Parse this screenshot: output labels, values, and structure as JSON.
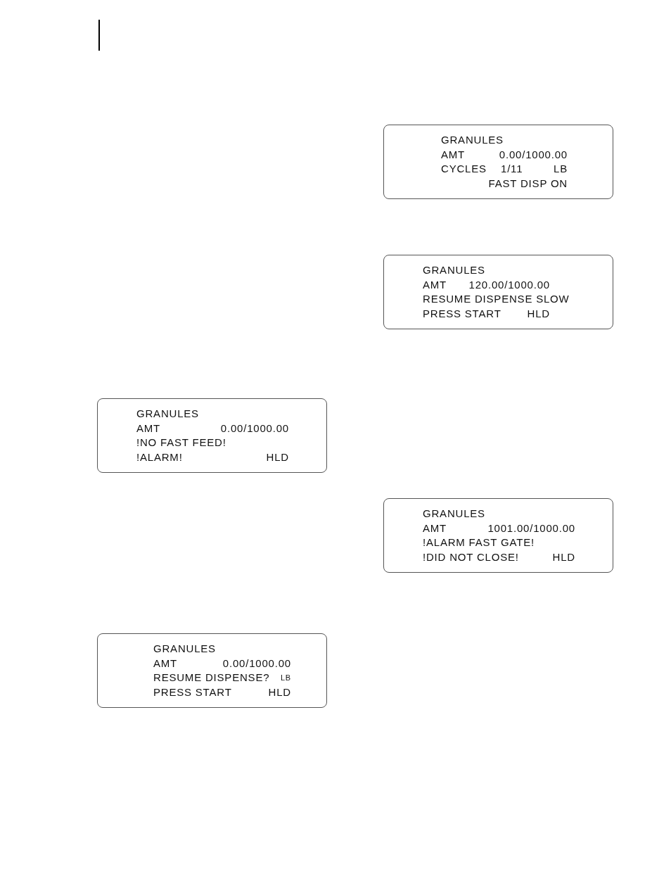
{
  "left_column": {
    "displays": [
      {
        "material": "GRANULES",
        "lines": [
          {
            "label": "AMT",
            "value": "0.00/1000.00"
          },
          {
            "label": "!NO FAST FEED!"
          },
          {
            "label": "!ALARM!",
            "status": "HLD"
          }
        ]
      },
      {
        "material": "GRANULES",
        "lines": [
          {
            "label": "AMT",
            "value": "0.00/1000.00"
          },
          {
            "label": "RESUME DISPENSE?",
            "unit": "LB"
          },
          {
            "label": "PRESS START",
            "status": "HLD"
          }
        ]
      }
    ]
  },
  "right_column": {
    "displays": [
      {
        "material": "GRANULES",
        "lines": [
          {
            "label": "AMT",
            "value": "0.00/1000.00"
          },
          {
            "label": "CYCLES",
            "value": "1/11",
            "unit": "LB"
          },
          {
            "value": "FAST DISP ON"
          }
        ]
      },
      {
        "material": "GRANULES",
        "lines": [
          {
            "label": "AMT",
            "value": "120.00/1000.00"
          },
          {
            "label": "RESUME DISPENSE SLOW"
          },
          {
            "label": "PRESS START",
            "status": "HLD"
          }
        ]
      },
      {
        "material": "GRANULES",
        "lines": [
          {
            "label": "AMT",
            "value": "1001.00/1000.00"
          },
          {
            "label": "!ALARM FAST GATE!"
          },
          {
            "label": "!DID NOT CLOSE!",
            "status": "HLD"
          }
        ]
      }
    ]
  }
}
